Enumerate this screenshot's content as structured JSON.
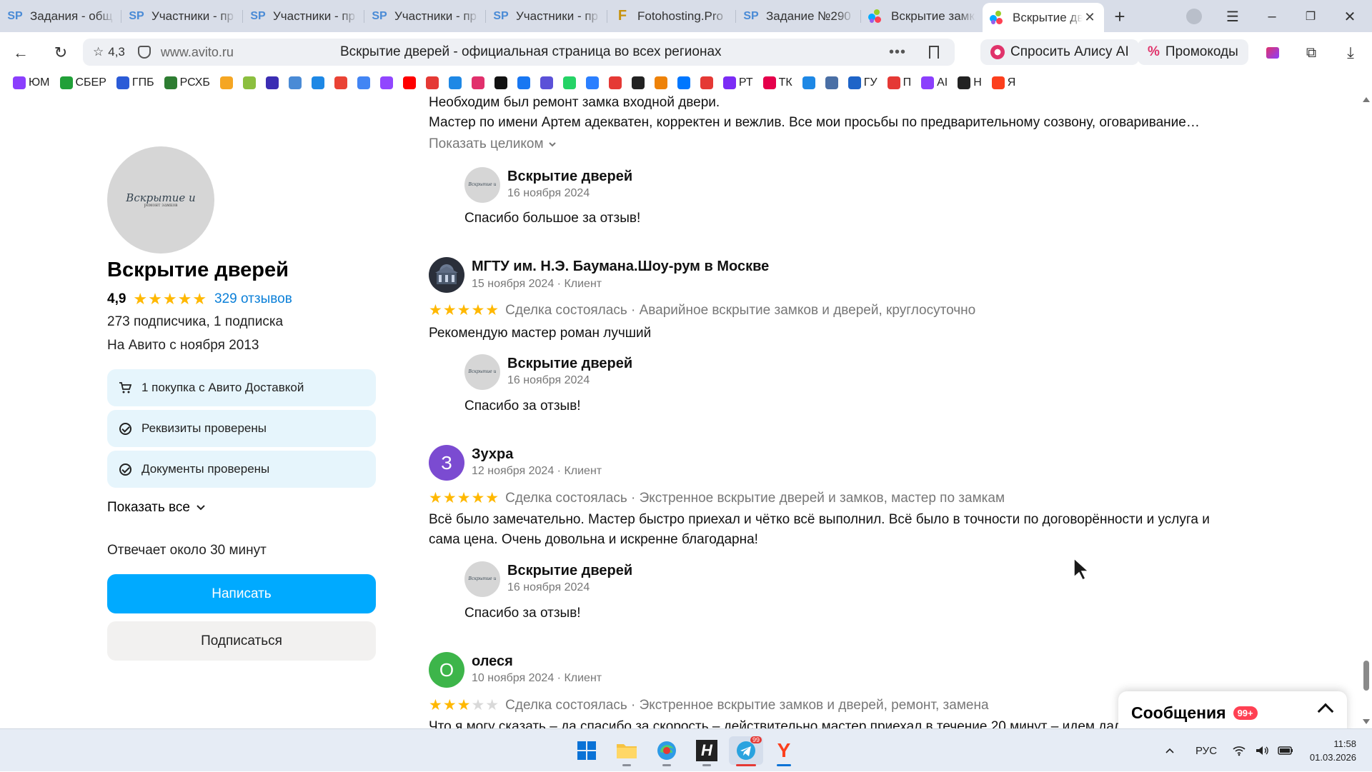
{
  "browser": {
    "tabs": [
      {
        "label": "Задания - общ",
        "favicon": "sp-icon"
      },
      {
        "label": "Участники - пр",
        "favicon": "sp-icon"
      },
      {
        "label": "Участники - пр",
        "favicon": "sp-icon"
      },
      {
        "label": "Участники - пр",
        "favicon": "sp-icon"
      },
      {
        "label": "Участники - пр",
        "favicon": "sp-icon"
      },
      {
        "label": "Fotohosting.Pro",
        "favicon": "fotohosting-icon"
      },
      {
        "label": "Задание №290",
        "favicon": "sp-icon"
      },
      {
        "label": "Вскрытие замк",
        "favicon": "avito-icon"
      },
      {
        "label": "Вскрытие дв",
        "favicon": "avito-icon",
        "active": true
      }
    ],
    "address": {
      "rating": "4,3",
      "domain": "www.avito.ru",
      "page_title": "Вскрытие дверей - официальная страница во всех регионах"
    },
    "ask_alice": "Спросить Алису AI",
    "promo": "Промокоды",
    "bookmarks": [
      {
        "label": "ЮМ",
        "color": "#8b3ffd"
      },
      {
        "label": "СБЕР",
        "color": "#21a038"
      },
      {
        "label": "ГПБ",
        "color": "#2b5bd7"
      },
      {
        "label": "РСХБ",
        "color": "#2e7d32"
      },
      {
        "label": "",
        "color": "#f5a623"
      },
      {
        "label": "",
        "color": "#8cbf3f"
      },
      {
        "label": "",
        "color": "#3b2db3"
      },
      {
        "label": "",
        "color": "#4a8bd6"
      },
      {
        "label": "",
        "color": "#1e88e5"
      },
      {
        "label": "",
        "color": "#ea4335"
      },
      {
        "label": "",
        "color": "#4285f4"
      },
      {
        "label": "",
        "color": "#9146ff"
      },
      {
        "label": "",
        "color": "#ff0000"
      },
      {
        "label": "",
        "color": "#e53935"
      },
      {
        "label": "",
        "color": "#1e88e5"
      },
      {
        "label": "",
        "color": "#e1306c"
      },
      {
        "label": "",
        "color": "#111111"
      },
      {
        "label": "",
        "color": "#1877f2"
      },
      {
        "label": "",
        "color": "#5b51d8"
      },
      {
        "label": "",
        "color": "#25d366"
      },
      {
        "label": "",
        "color": "#2b7fff"
      },
      {
        "label": "",
        "color": "#e53935"
      },
      {
        "label": "",
        "color": "#222222"
      },
      {
        "label": "",
        "color": "#ee8208"
      },
      {
        "label": "",
        "color": "#0077ff"
      },
      {
        "label": "",
        "color": "#e53935"
      },
      {
        "label": "РТ",
        "color": "#7b2cf5"
      },
      {
        "label": "ТК",
        "color": "#e5004b"
      },
      {
        "label": "",
        "color": "#1e88e5"
      },
      {
        "label": "",
        "color": "#4a6fa5"
      },
      {
        "label": "ГУ",
        "color": "#1e64c8"
      },
      {
        "label": "П",
        "color": "#e53935"
      },
      {
        "label": "AI",
        "color": "#8b3ffd"
      },
      {
        "label": "Н",
        "color": "#222222"
      },
      {
        "label": "Я",
        "color": "#fc3f1d"
      }
    ]
  },
  "seller": {
    "name": "Вскрытие дверей",
    "rating": "4,9",
    "stars": "★★★★★",
    "reviews_link": "329 отзывов",
    "subscribers": "273 подписчика, 1 подписка",
    "since": "На Авито с ноября 2013",
    "badges": [
      {
        "label": "1 покупка с Авито Доставкой",
        "icon": "cart-icon"
      },
      {
        "label": "Реквизиты проверены",
        "icon": "check-circle-icon"
      },
      {
        "label": "Документы проверены",
        "icon": "check-circle-icon"
      }
    ],
    "show_all": "Показать все",
    "response_time": "Отвечает около 30 минут",
    "write_button": "Написать",
    "subscribe_button": "Подписаться",
    "logo_text": "Вскрытие и",
    "logo_sub": "ремонт замков"
  },
  "reviews": {
    "top_partial": {
      "line1": "Необходим был ремонт замка входной двери.",
      "line2": "Мастер по имени Артем адекватен, корректен и вежлив. Все мои просьбы по предварительному созвону, оговаривание…",
      "show_full": "Показать целиком"
    },
    "reply_author": "Вскрытие дверей",
    "items": [
      {
        "reply_date": "16 ноября 2024",
        "reply_text": "Спасибо большое за отзыв!"
      },
      {
        "author": "МГТУ им. Н.Э. Баумана.Шоу-рум в Москве",
        "date": "15 ноября 2024 · Клиент",
        "stars_filled": 5,
        "stars": "★★★★★",
        "deal": "Сделка состоялась · Аварийное вскрытие замков и дверей, круглосуточно",
        "text": "Рекомендую мастер роман лучший",
        "reply_date": "16 ноября 2024",
        "reply_text": "Спасибо за отзыв!"
      },
      {
        "author": "Зухра",
        "initial": "З",
        "avatar_color": "#7b4bd1",
        "date": "12 ноября 2024 · Клиент",
        "stars_filled": 5,
        "stars": "★★★★★",
        "deal": "Сделка состоялась · Экстренное вскрытие дверей и замков, мастер по замкам",
        "text_line1": "Всё было замечательно. Мастер быстро приехал и чётко всё выполнил. Всё было в точности по договорённости и услуга и",
        "text_line2": "сама цена. Очень довольна и искренне благодарна!",
        "reply_date": "16 ноября 2024",
        "reply_text": "Спасибо за отзыв!"
      },
      {
        "author": "олеся",
        "initial": "О",
        "avatar_color": "#3db54a",
        "date": "10 ноября 2024 · Клиент",
        "stars_filled": 3,
        "stars_on": "★★★",
        "stars_off": "★★",
        "deal": "Сделка состоялась · Экстренное вскрытие замков и дверей, ремонт, замена",
        "text_partial": "Что я могу сказать – да спасибо за скорость – действительно мастер приехал в течение 20 минут – идем дал"
      }
    ]
  },
  "messages_widget": {
    "title": "Сообщения",
    "count": "99+"
  },
  "taskbar": {
    "telegram_badge": "99",
    "lang": "РУС",
    "time": "11:58",
    "date": "01.03.2026"
  }
}
